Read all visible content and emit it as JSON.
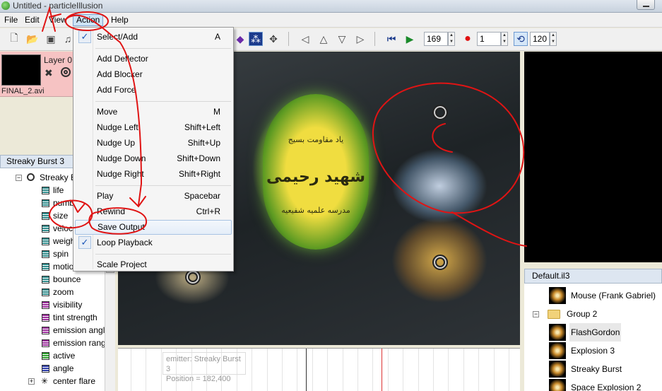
{
  "window": {
    "title": "Untitled - particleIllusion"
  },
  "menubar": {
    "file": "File",
    "edit": "Edit",
    "view": "View",
    "action": "Action",
    "help": "Help"
  },
  "toolbar": {
    "frame_value": "169",
    "record_value": "1",
    "loop_value": "120"
  },
  "layer": {
    "name": "Layer 0",
    "file": "FINAL_2.avi"
  },
  "emitter_tree": {
    "header": "Streaky Burst 3",
    "root": "Streaky B",
    "properties": [
      {
        "label": "life",
        "color": "#2d8a8a"
      },
      {
        "label": "number",
        "color": "#2d8a8a"
      },
      {
        "label": "size",
        "color": "#2d8a8a"
      },
      {
        "label": "velocity",
        "color": "#2d8a8a"
      },
      {
        "label": "weight",
        "color": "#2d8a8a"
      },
      {
        "label": "spin",
        "color": "#2d8a8a"
      },
      {
        "label": "motion rand",
        "color": "#2d8a8a"
      },
      {
        "label": "bounce",
        "color": "#2d8a8a"
      },
      {
        "label": "zoom",
        "color": "#2d8a8a"
      },
      {
        "label": "visibility",
        "color": "#9a2d9a"
      },
      {
        "label": "tint strength",
        "color": "#9a2d9a"
      },
      {
        "label": "emission angle",
        "color": "#9a2d9a"
      },
      {
        "label": "emission range",
        "color": "#9a2d9a"
      },
      {
        "label": "active",
        "color": "#2da02d"
      },
      {
        "label": "angle",
        "color": "#2d3ca8"
      }
    ],
    "child": "center flare"
  },
  "action_menu": {
    "items": [
      {
        "label": "Select/Add",
        "shortcut": "A",
        "checked": true
      },
      {
        "separator": true
      },
      {
        "label": "Add Deflector",
        "shortcut": ""
      },
      {
        "label": "Add Blocker",
        "shortcut": ""
      },
      {
        "label": "Add Force",
        "shortcut": ""
      },
      {
        "separator": true
      },
      {
        "label": "Move",
        "shortcut": "M"
      },
      {
        "label": "Nudge Left",
        "shortcut": "Shift+Left"
      },
      {
        "label": "Nudge Up",
        "shortcut": "Shift+Up"
      },
      {
        "label": "Nudge Down",
        "shortcut": "Shift+Down"
      },
      {
        "label": "Nudge Right",
        "shortcut": "Shift+Right"
      },
      {
        "separator": true
      },
      {
        "label": "Play",
        "shortcut": "Spacebar"
      },
      {
        "label": "Rewind",
        "shortcut": "Ctrl+R"
      },
      {
        "label": "Save Output",
        "shortcut": "",
        "hover": true
      },
      {
        "label": "Loop Playback",
        "shortcut": "",
        "checked": true
      },
      {
        "separator": true
      },
      {
        "label": "Scale Project",
        "shortcut": ""
      }
    ]
  },
  "canvas": {
    "text_top": "یاد مقاومت بسیج",
    "text_main": "شهید رحیمی",
    "text_bottom": "مدرسه علمیه شفیعیه"
  },
  "library": {
    "header": "Default.il3",
    "items": [
      {
        "label": "Mouse (Frank Gabriel)",
        "type": "emitter"
      },
      {
        "label": "Group 2",
        "type": "folder"
      },
      {
        "label": "FlashGordon",
        "type": "emitter",
        "selected": true
      },
      {
        "label": "Explosion 3",
        "type": "emitter"
      },
      {
        "label": "Streaky Burst",
        "type": "emitter"
      },
      {
        "label": "Space Explosion 2",
        "type": "emitter"
      }
    ]
  },
  "timeline": {
    "emitter_label": "emitter:  Streaky Burst 3",
    "position_label": "Position = 182,400"
  },
  "colors": {
    "menu_highlight": "#cde4f7",
    "layer_bg": "#f6c3c3",
    "annotation": "#e01414"
  }
}
